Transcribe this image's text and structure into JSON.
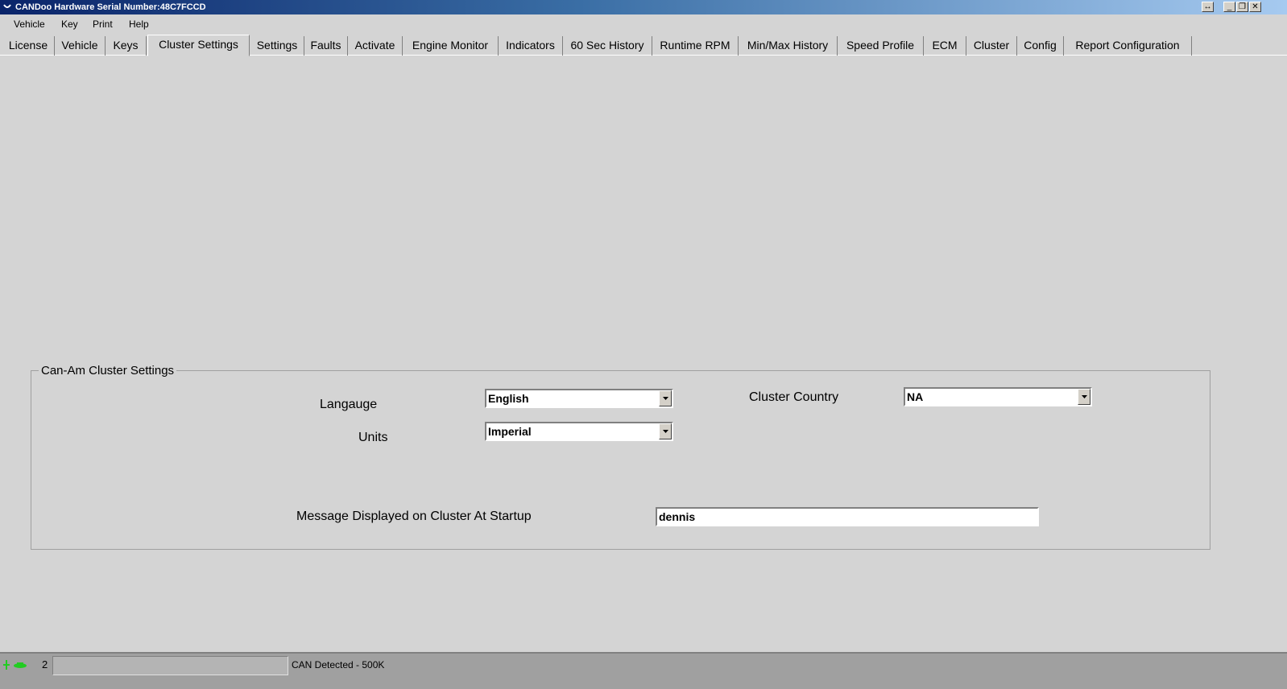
{
  "window": {
    "title": "CANDoo  Hardware Serial Number:48C7FCCD",
    "buttons": {
      "resize": "↔",
      "minimize": "_",
      "restore": "❐",
      "close": "✕"
    }
  },
  "menu": [
    "Vehicle",
    "Key",
    "Print",
    "Help"
  ],
  "tabs": [
    "License",
    "Vehicle",
    "Keys",
    "Cluster Settings",
    "Settings",
    "Faults",
    "Activate",
    "Engine Monitor",
    "Indicators",
    "60 Sec History",
    "Runtime RPM",
    "Min/Max History",
    "Speed Profile",
    "ECM",
    "Cluster",
    "Config",
    "Report Configuration"
  ],
  "active_tab": "Cluster Settings",
  "group": {
    "title": "Can-Am Cluster Settings",
    "language_label": "Langauge",
    "language_value": "English",
    "units_label": "Units",
    "units_value": "Imperial",
    "country_label": "Cluster Country",
    "country_value": "NA",
    "message_label": "Message Displayed on Cluster At Startup",
    "message_value": "dennis"
  },
  "status": {
    "count": "2",
    "text": "CAN Detected - 500K"
  },
  "colors": {
    "accent": "#0a246a",
    "background": "#d4d4d4",
    "status_icon": "#22cc22"
  }
}
